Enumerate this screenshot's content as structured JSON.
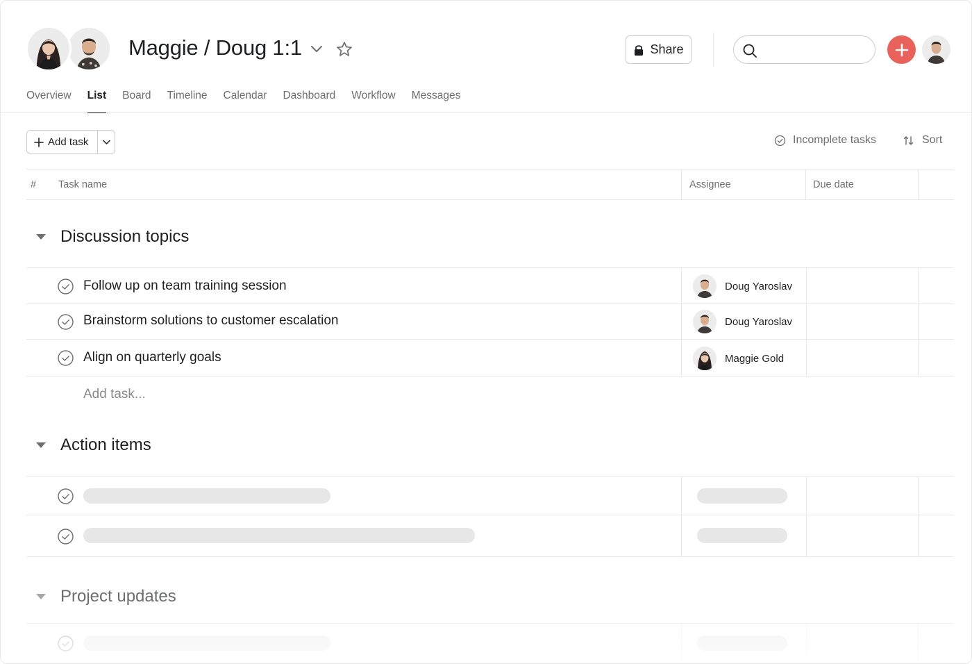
{
  "project": {
    "title": "Maggie / Doug 1:1",
    "members": [
      "Maggie Gold",
      "Doug Yaroslav"
    ]
  },
  "header": {
    "share_label": "Share",
    "search_placeholder": "",
    "accent_color": "#e8615a"
  },
  "tabs": [
    {
      "label": "Overview",
      "active": false
    },
    {
      "label": "List",
      "active": true
    },
    {
      "label": "Board",
      "active": false
    },
    {
      "label": "Timeline",
      "active": false
    },
    {
      "label": "Calendar",
      "active": false
    },
    {
      "label": "Dashboard",
      "active": false
    },
    {
      "label": "Workflow",
      "active": false
    },
    {
      "label": "Messages",
      "active": false
    }
  ],
  "toolbar": {
    "add_task_label": "Add task",
    "filter_label": "Incomplete tasks",
    "sort_label": "Sort"
  },
  "table": {
    "columns": {
      "index": "#",
      "task_name": "Task name",
      "assignee": "Assignee",
      "due_date": "Due date"
    }
  },
  "sections": [
    {
      "name": "Discussion topics",
      "tasks": [
        {
          "name": "Follow up on team training session",
          "assignee": "Doug Yaroslav",
          "due_date": ""
        },
        {
          "name": "Brainstorm solutions to customer escalation",
          "assignee": "Doug Yaroslav",
          "due_date": ""
        },
        {
          "name": "Align on quarterly goals",
          "assignee": "Maggie Gold",
          "due_date": ""
        }
      ],
      "add_task_label": "Add task..."
    },
    {
      "name": "Action items"
    },
    {
      "name": "Project updates"
    }
  ],
  "icons": [
    "chevron-down-icon",
    "star-icon",
    "lock-icon",
    "search-icon",
    "plus-icon",
    "check-circle-icon",
    "sort-icon",
    "triangle-down-icon"
  ]
}
